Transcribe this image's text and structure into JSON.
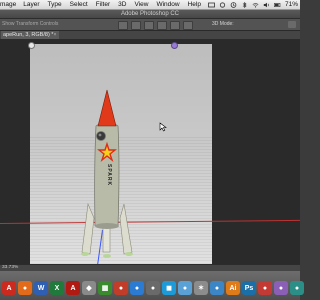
{
  "menubar": {
    "items": [
      "mage",
      "Layer",
      "Type",
      "Select",
      "Filter",
      "3D",
      "View",
      "Window",
      "Help"
    ],
    "battery_percent": "71%"
  },
  "app": {
    "title": "Adobe Photoshop CC"
  },
  "options": {
    "label": "Show Transform Controls",
    "mode_label": "3D Mode:"
  },
  "document": {
    "tab_label": "apeRun, 3, RGB/8) *",
    "close_glyph": "×"
  },
  "canvas": {
    "rocket_label": "SPARK",
    "colors": {
      "rocket_body": "#b5b8a6",
      "nose_cone": "#e03a1a",
      "star": "#e02b1a",
      "star_fill": "#f2d21b",
      "axis_x": "#b33333",
      "axis_y": "#3b55ff",
      "widget_right": "#9a7ad6"
    }
  },
  "statusbar": {
    "zoom": "33.73%"
  },
  "dock": {
    "icons": [
      {
        "name": "acrobat-icon",
        "glyph": "A",
        "color": "#cc2a1f"
      },
      {
        "name": "firefox-icon",
        "glyph": "●",
        "color": "#e26a1b"
      },
      {
        "name": "word-icon",
        "glyph": "W",
        "color": "#2f5fb3"
      },
      {
        "name": "excel-icon",
        "glyph": "X",
        "color": "#1f7a3c"
      },
      {
        "name": "acrobat-pro-icon",
        "glyph": "A",
        "color": "#b11a12"
      },
      {
        "name": "app-icon-6",
        "glyph": "◆",
        "color": "#8a8a8a"
      },
      {
        "name": "spreadsheet-icon",
        "glyph": "▦",
        "color": "#3a8a2e"
      },
      {
        "name": "app-icon-8",
        "glyph": "●",
        "color": "#c23c2a"
      },
      {
        "name": "app-icon-9",
        "glyph": "●",
        "color": "#2a7bd1"
      },
      {
        "name": "app-icon-10",
        "glyph": "●",
        "color": "#6a6a6a"
      },
      {
        "name": "app-icon-11",
        "glyph": "◼",
        "color": "#1d9bd9"
      },
      {
        "name": "app-icon-12",
        "glyph": "●",
        "color": "#5aa2d6"
      },
      {
        "name": "app-icon-13",
        "glyph": "✶",
        "color": "#8c8c8c"
      },
      {
        "name": "app-icon-14",
        "glyph": "●",
        "color": "#3c86c6"
      },
      {
        "name": "app-icon-15",
        "glyph": "Ai",
        "color": "#e07b1a"
      },
      {
        "name": "photoshop-icon",
        "glyph": "Ps",
        "color": "#1a6fa8"
      },
      {
        "name": "app-icon-17",
        "glyph": "●",
        "color": "#c23a33"
      },
      {
        "name": "app-icon-18",
        "glyph": "●",
        "color": "#8b5fb5"
      },
      {
        "name": "app-icon-19",
        "glyph": "●",
        "color": "#2c8f87"
      }
    ]
  }
}
